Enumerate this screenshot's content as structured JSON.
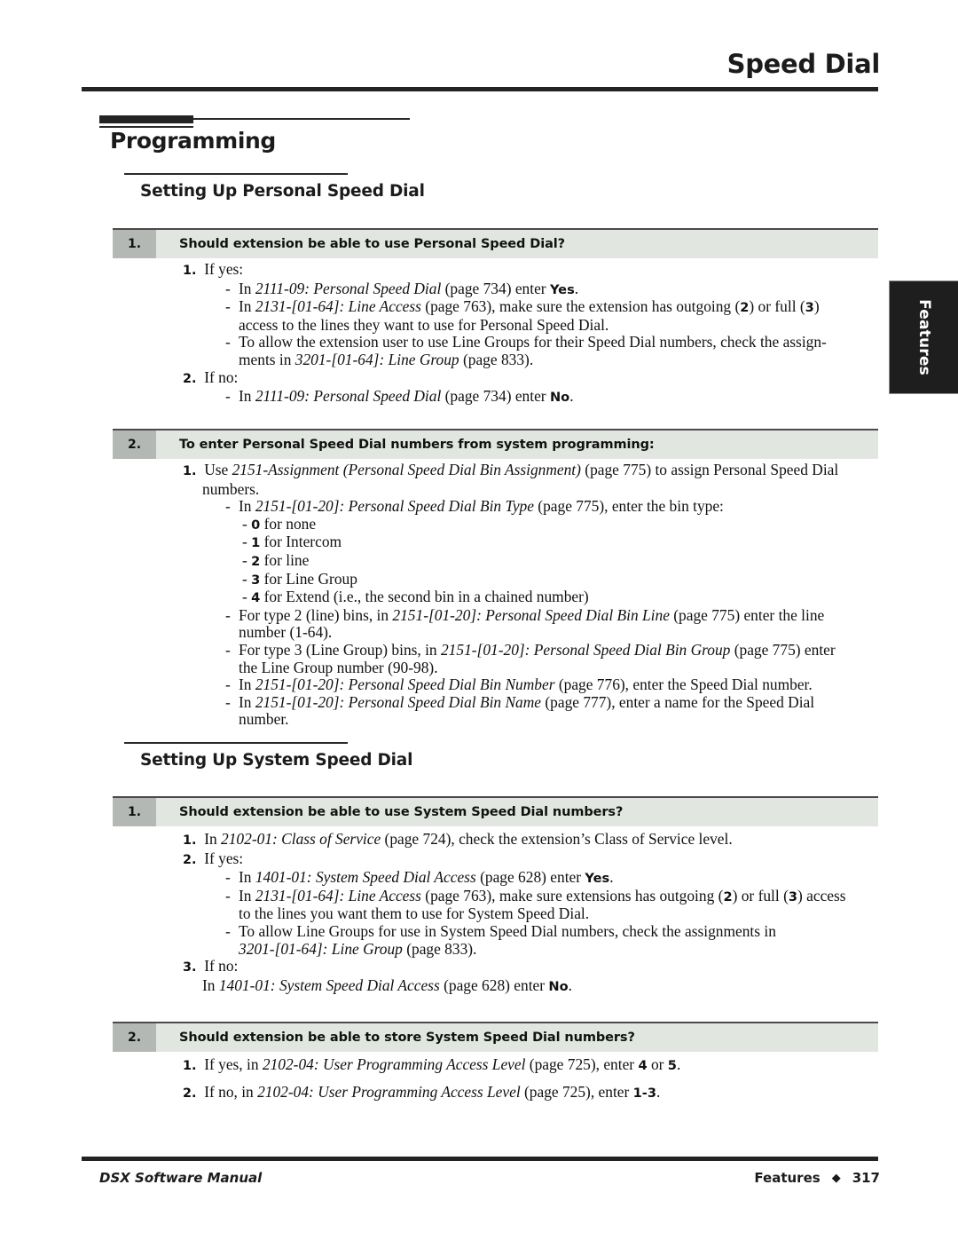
{
  "header": {
    "running_head": "Speed Dial"
  },
  "chapter": {
    "heading": "Programming"
  },
  "sections": [
    {
      "heading": "Setting Up Personal Speed Dial",
      "questions": [
        {
          "number": "1.",
          "title": "Should extension be able to use Personal Speed Dial?",
          "lines": [
            "1.|If yes:",
            "-|In |2111-09: Personal Speed Dial| (page 734) enter |Yes|.",
            "-|In |2131-[01-64]: Line Access| (page 763), make sure the extension has outgoing (|2|) or full (|3|)",
            "access to the lines they want to use for Personal Speed Dial.",
            "-|To allow the extension user to use Line Groups for their Speed Dial numbers, check the assign-",
            "ments in |3201-[01-64]: Line Group| (page 833).",
            "2.|If no:",
            "-|In |2111-09: Personal Speed Dial| (page 734) enter |No|."
          ]
        },
        {
          "number": "2.",
          "title": "To enter Personal Speed Dial numbers from system programming:",
          "lines": [
            "1.|Use |2151-Assignment (Personal Speed Dial Bin Assignment)| (page 775) to assign Personal Speed Dial",
            "numbers.",
            "-|In |2151-[01-20]: Personal Speed Dial Bin Type| (page 775), enter the bin type:",
            "- |0| for none",
            "- |1| for Intercom",
            "- |2| for line",
            "- |3| for Line Group",
            "- |4| for Extend (i.e., the second bin in a chained number)",
            "-|For type 2 (line) bins, in |2151-[01-20]: Personal Speed Dial Bin Line| (page 775) enter the line",
            "number (1-64).",
            "-|For type 3 (Line Group) bins, in |2151-[01-20]: Personal Speed Dial Bin Group| (page 775) enter",
            "the Line Group number (90-98).",
            "-|In |2151-[01-20]: Personal Speed Dial Bin Number| (page 776), enter the Speed Dial number.",
            "-|In |2151-[01-20]: Personal Speed Dial Bin Name| (page 777), enter a name for the Speed Dial",
            "number."
          ]
        }
      ]
    },
    {
      "heading": "Setting Up System Speed Dial",
      "questions": [
        {
          "number": "1.",
          "title": "Should extension be able to use System Speed Dial numbers?",
          "lines": [
            "1.|In |2102-01: Class of Service| (page 724), check the extension's Class of Service level.",
            "2.|If yes:",
            "-|In |1401-01: System Speed Dial Access| (page 628) enter |Yes|.",
            "-|In |2131-[01-64]: Line Access| (page 763), make sure extensions has outgoing (|2|) or full (|3|) access",
            "to the lines you want them to use for System Speed Dial.",
            "-|To allow Line Groups for use in System Speed Dial numbers, check the assignments in",
            "3201-[01-64]: Line Group| (page 833).",
            "3.|If no:",
            "In |1401-01: System Speed Dial Access| (page 628) enter |No|."
          ]
        },
        {
          "number": "2.",
          "title": "Should extension be able to store System Speed Dial numbers?",
          "lines": [
            "1.|If yes, in |2102-04: User Programming Access Level| (page 725), enter |4| or |5|.",
            "2.|If no, in |2102-04: User Programming Access Level| (page 725), enter |1-3|."
          ]
        }
      ]
    }
  ],
  "thumb_tab": {
    "label": "Features"
  },
  "footer": {
    "left": "DSX Software Manual",
    "section": "Features",
    "separator": "◆",
    "page_number": "317"
  },
  "s1q1": {
    "l1_num": "1.",
    "l1_text": "If yes:",
    "l2_in": "In ",
    "l2_ref": "2111-09: Personal Speed Dial",
    "l2_page": " (page 734) enter ",
    "l2_val": "Yes",
    "l2_end": ".",
    "l3_in": "In ",
    "l3_ref": "2131-[01-64]: Line Access",
    "l3_mid": " (page 763), make sure the extension has outgoing (",
    "l3_b1": "2",
    "l3_mid2": ") or full (",
    "l3_b2": "3",
    "l3_end": ")",
    "l4": "access to the lines they want to use for Personal Speed Dial.",
    "l5": "To allow the extension user to use Line Groups for their Speed Dial numbers, check the assign-",
    "l6_pre": "ments in ",
    "l6_ref": "3201-[01-64]: Line Group",
    "l6_end": " (page 833).",
    "l7_num": "2.",
    "l7_text": "If no:",
    "l8_in": "In ",
    "l8_ref": "2111-09: Personal Speed Dial",
    "l8_page": " (page 734) enter ",
    "l8_val": "No",
    "l8_end": "."
  },
  "s1q2": {
    "l1_num": "1.",
    "l1_pre": "Use ",
    "l1_ref": "2151-Assignment (Personal Speed Dial Bin Assignment)",
    "l1_end": " (page 775) to assign Personal Speed Dial",
    "l2": "numbers.",
    "l3_in": "In ",
    "l3_ref": "2151-[01-20]: Personal Speed Dial Bin Type",
    "l3_end": " (page 775), enter the bin type:",
    "b0_dash": "- ",
    "b0_num": "0",
    "b0_text": " for none",
    "b1_dash": "- ",
    "b1_num": "1",
    "b1_text": " for Intercom",
    "b2_dash": "- ",
    "b2_num": "2",
    "b2_text": " for line",
    "b3_dash": "- ",
    "b3_num": "3",
    "b3_text": " for Line Group",
    "b4_dash": "- ",
    "b4_num": "4",
    "b4_text": " for Extend (i.e., the second bin in a chained number)",
    "l9_pre": "For type 2 (line) bins, in ",
    "l9_ref": "2151-[01-20]: Personal Speed Dial Bin Line",
    "l9_end": " (page 775) enter the line",
    "l10": "number (1-64).",
    "l11_pre": "For type 3 (Line Group) bins, in ",
    "l11_ref": "2151-[01-20]: Personal Speed Dial Bin Group",
    "l11_end": " (page 775) enter",
    "l12": "the Line Group number (90-98).",
    "l13_in": "In ",
    "l13_ref": "2151-[01-20]: Personal Speed Dial Bin Number",
    "l13_end": " (page 776), enter the Speed Dial number.",
    "l14_in": "In ",
    "l14_ref": "2151-[01-20]: Personal Speed Dial Bin Name",
    "l14_end": " (page 777), enter a name for the Speed Dial",
    "l15": "number."
  },
  "s2q1": {
    "l1_num": "1.",
    "l1_in": "In ",
    "l1_ref": "2102-01: Class of Service",
    "l1_end": " (page 724), check the extension’s Class of Service level.",
    "l2_num": "2.",
    "l2_text": "If yes:",
    "l3_in": "In ",
    "l3_ref": "1401-01: System Speed Dial Access",
    "l3_page": " (page 628) enter ",
    "l3_val": "Yes",
    "l3_end": ".",
    "l4_in": "In ",
    "l4_ref": "2131-[01-64]: Line Access",
    "l4_mid": " (page 763), make sure extensions has outgoing (",
    "l4_b1": "2",
    "l4_mid2": ") or full (",
    "l4_b2": "3",
    "l4_end": ") access",
    "l5": "to the lines you want them to use for System Speed Dial.",
    "l6": "To allow Line Groups for use in System Speed Dial numbers, check the assignments in",
    "l7_ref": "3201-[01-64]: Line Group",
    "l7_end": " (page 833).",
    "l8_num": "3.",
    "l8_text": "If no:",
    "l9_in": "In ",
    "l9_ref": "1401-01: System Speed Dial Access",
    "l9_page": " (page 628) enter ",
    "l9_val": "No",
    "l9_end": "."
  },
  "s2q2": {
    "l1_num": "1.",
    "l1_pre": "If yes, in ",
    "l1_ref": "2102-04: User Programming Access Level",
    "l1_mid": " (page 725), enter ",
    "l1_b1": "4",
    "l1_mid2": " or ",
    "l1_b2": "5",
    "l1_end": ".",
    "l2_num": "2.",
    "l2_pre": "If no, in ",
    "l2_ref": "2102-04: User Programming Access Level",
    "l2_mid": " (page 725), enter ",
    "l2_b1": "1-3",
    "l2_end": "."
  }
}
